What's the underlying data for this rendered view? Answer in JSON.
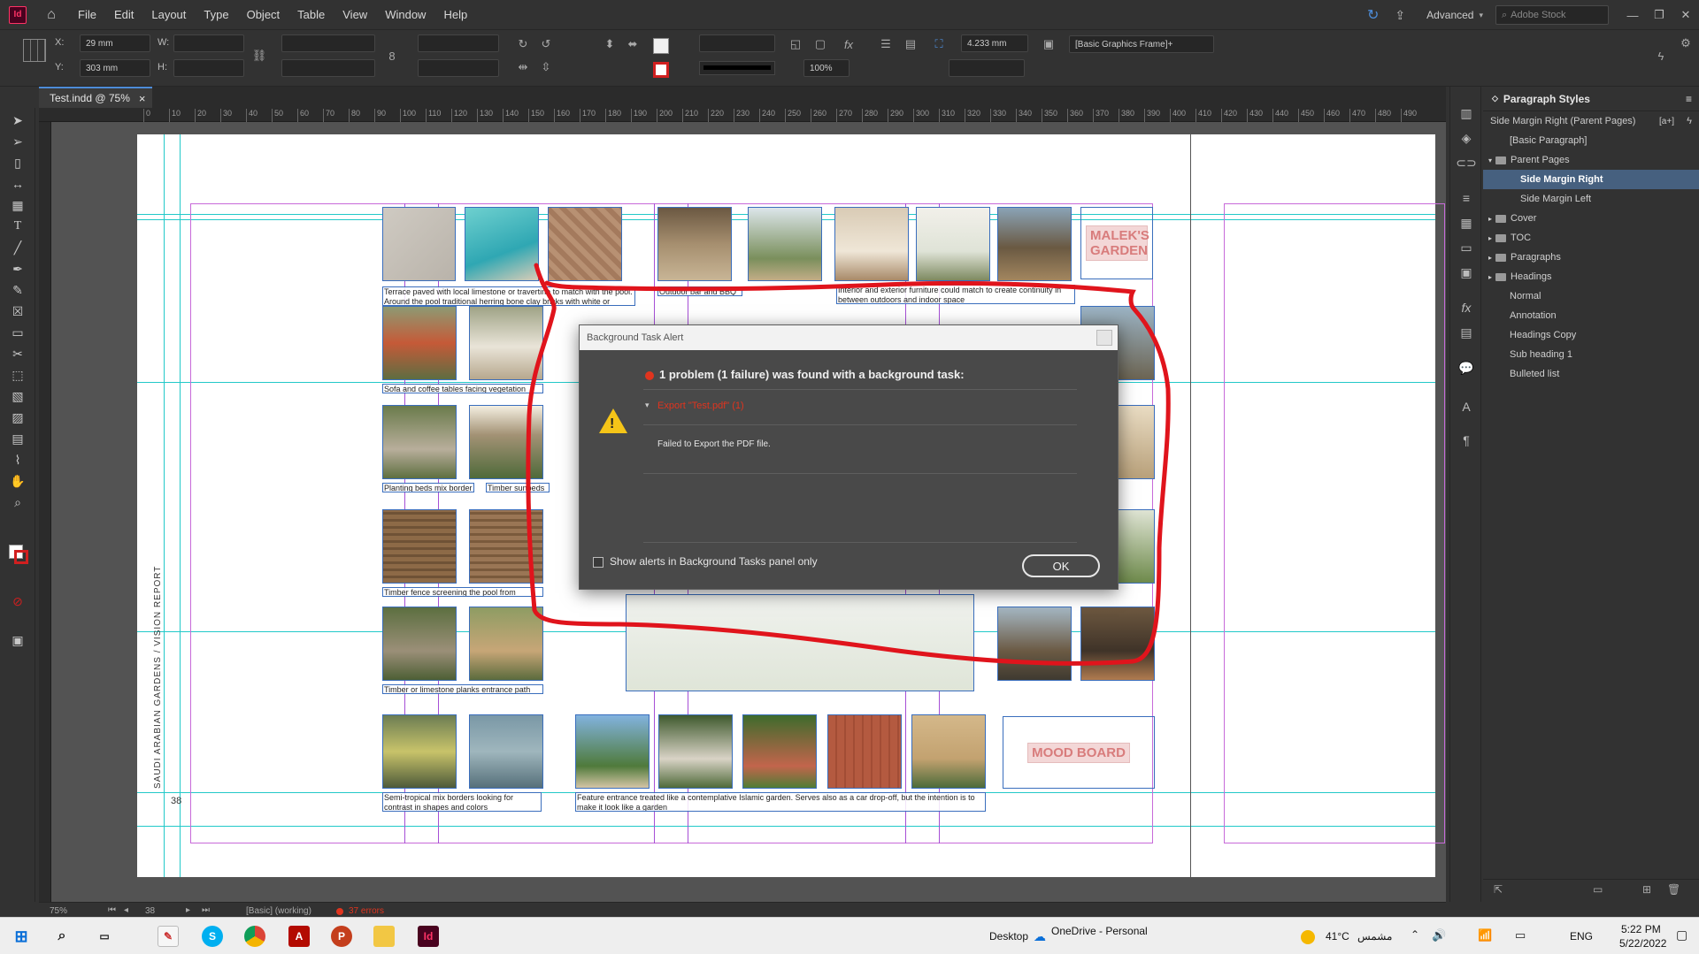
{
  "app": {
    "logo": "Id",
    "menus": [
      "File",
      "Edit",
      "Layout",
      "Type",
      "Object",
      "Table",
      "View",
      "Window",
      "Help"
    ],
    "workspace": "Advanced",
    "search_placeholder": "Adobe Stock"
  },
  "control_bar": {
    "x_label": "X:",
    "x_value": "29 mm",
    "y_label": "Y:",
    "y_value": "303 mm",
    "w_label": "W:",
    "h_label": "H:",
    "stroke_weight": "4.233 mm",
    "zoom_percent": "100%",
    "object_style": "[Basic Graphics Frame]+"
  },
  "document_tab": {
    "title": "Test.indd @ 75%",
    "close": "×"
  },
  "ruler_marks": [
    "0",
    "10",
    "20",
    "30",
    "40",
    "50",
    "60",
    "70",
    "80",
    "90",
    "100",
    "110",
    "120",
    "130",
    "140",
    "150",
    "160",
    "170",
    "180",
    "190",
    "200",
    "210",
    "220",
    "230",
    "240",
    "250",
    "260",
    "270",
    "280",
    "290",
    "300",
    "310",
    "320",
    "330",
    "340",
    "350",
    "360",
    "370",
    "380",
    "390",
    "400",
    "410",
    "420",
    "430",
    "440",
    "450",
    "460",
    "470",
    "480",
    "490",
    "500",
    "510"
  ],
  "page": {
    "vertical_title": "SAUDI ARABIAN GARDENS / VISION REPORT",
    "page_number": "38",
    "title_top": "MALEK'S GARDEN",
    "title_bottom": "MOOD BOARD",
    "captions": {
      "c1": "Terrace paved with local limestone or travertine to match with the pool. Around the pool traditional herring bone clay bricks with white or",
      "c2": "Outdoor bar and BBQ",
      "c3": "Interior and exterior furniture could match to create continuity in between outdoors and indoor space",
      "c4": "Sofa and coffee tables facing vegetation",
      "c5": "Planting beds mix border",
      "c6": "Timber sunbeds",
      "c7": "Timber fence screening the pool from visitors",
      "c8": "Timber or limestone planks entrance path",
      "c9": "Semi-tropical mix borders looking for contrast in shapes and colors",
      "c10": "Feature entrance treated like a contemplative Islamic garden. Serves also as a car drop-off, but the intention is to make it look like a garden"
    }
  },
  "dialog": {
    "title": "Background Task Alert",
    "heading": "1 problem (1 failure) was found with a background task:",
    "task_name": "Export \"Test.pdf\" (1)",
    "message": "Failed to Export the PDF file.",
    "checkbox_label": "Show alerts in Background Tasks panel only",
    "ok_label": "OK"
  },
  "paragraph_styles": {
    "panel_title": "Paragraph Styles",
    "current_style": "Side Margin Right (Parent Pages)",
    "items": [
      {
        "label": "[Basic Paragraph]",
        "indent": 1,
        "folder": false,
        "selected": false
      },
      {
        "label": "Parent Pages",
        "indent": 0,
        "folder": true,
        "selected": false
      },
      {
        "label": "Side Margin Right",
        "indent": 2,
        "folder": false,
        "selected": true
      },
      {
        "label": "Side Margin Left",
        "indent": 2,
        "folder": false,
        "selected": false
      },
      {
        "label": "Cover",
        "indent": 0,
        "folder": true,
        "selected": false
      },
      {
        "label": "TOC",
        "indent": 0,
        "folder": true,
        "selected": false
      },
      {
        "label": "Paragraphs",
        "indent": 0,
        "folder": true,
        "selected": false
      },
      {
        "label": "Headings",
        "indent": 0,
        "folder": true,
        "selected": false
      },
      {
        "label": "Normal",
        "indent": 1,
        "folder": false,
        "selected": false
      },
      {
        "label": "Annotation",
        "indent": 1,
        "folder": false,
        "selected": false
      },
      {
        "label": "Headings Copy",
        "indent": 1,
        "folder": false,
        "selected": false
      },
      {
        "label": "Sub heading 1",
        "indent": 1,
        "folder": false,
        "selected": false
      },
      {
        "label": "Bulleted list",
        "indent": 1,
        "folder": false,
        "selected": false
      }
    ]
  },
  "status_bar": {
    "zoom": "75%",
    "page": "38",
    "preflight_profile": "[Basic] (working)",
    "errors": "37 errors"
  },
  "taskbar": {
    "desktop_label": "Desktop",
    "onedrive_label": "OneDrive - Personal",
    "temperature": "41°C",
    "weather_text": "مشمس",
    "language": "ENG",
    "time": "5:22 PM",
    "date": "5/22/2022"
  }
}
